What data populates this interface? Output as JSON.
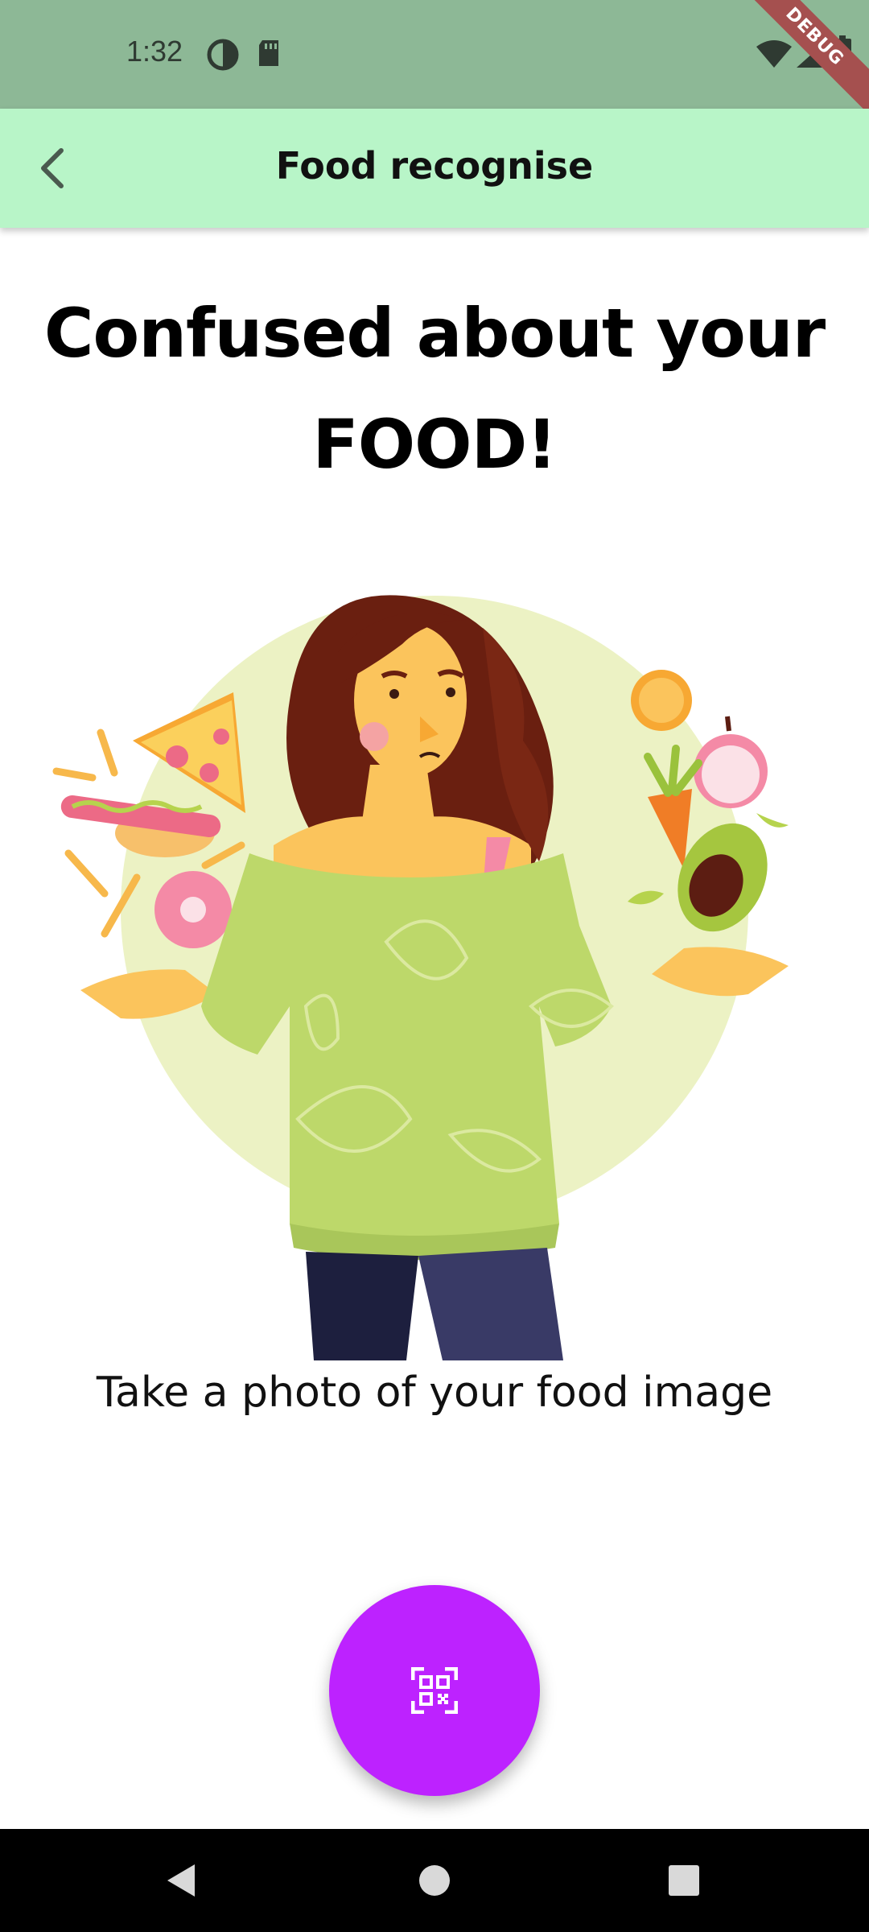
{
  "status_bar": {
    "time": "1:32",
    "debug_label": "DEBUG",
    "icons": [
      "data-saver-icon",
      "sd-card-icon",
      "wifi-icon",
      "cellular-signal-icon",
      "battery-icon"
    ]
  },
  "app_bar": {
    "title": "Food recognise",
    "back_icon": "chevron-left-icon",
    "background": "#b8f5c8"
  },
  "main": {
    "headline": "Confused about your FOOD!",
    "subtitle": "Take a photo of your food image",
    "illustration": "confused-woman-choosing-food-illustration"
  },
  "scan_button": {
    "icon": "qr-scan-icon",
    "color": "#bd22ff"
  },
  "nav_bar": {
    "buttons": [
      "back-triangle-icon",
      "home-circle-icon",
      "recents-square-icon"
    ]
  }
}
